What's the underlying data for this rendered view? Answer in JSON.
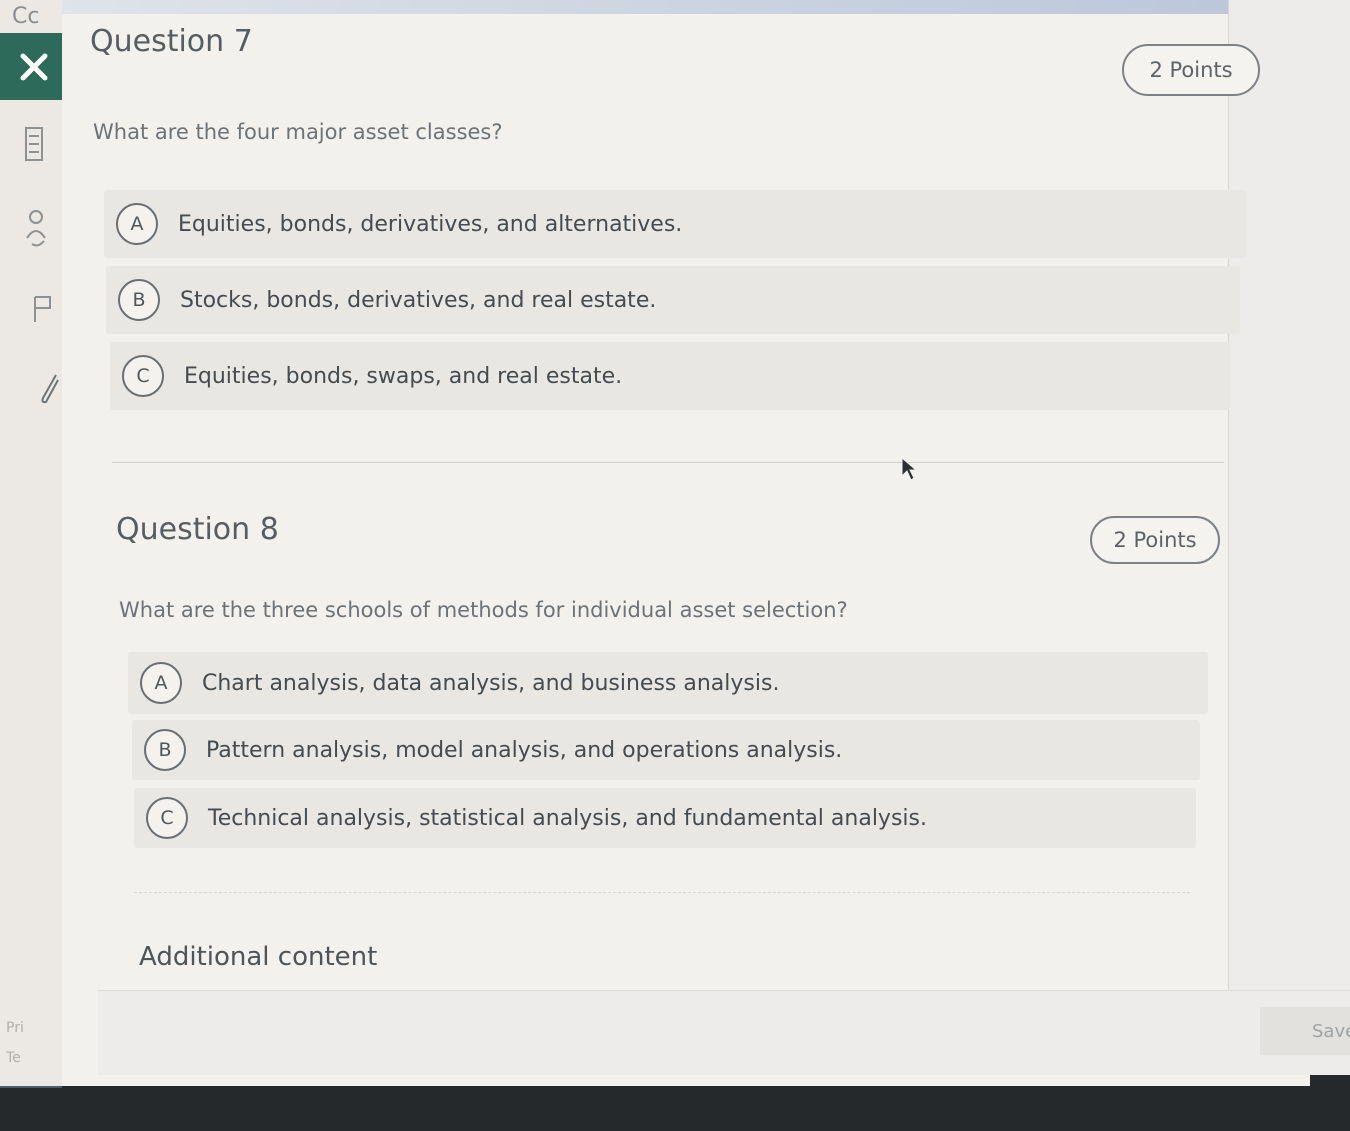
{
  "sidebar": {
    "top_text": "Cc",
    "close_icon": "✕",
    "bottom_text_1": "Pri",
    "bottom_text_2": "Te"
  },
  "questions": [
    {
      "title": "Question 7",
      "points": "2 Points",
      "text": "What are the four major asset classes?",
      "options": [
        {
          "letter": "A",
          "text": "Equities, bonds, derivatives, and alternatives."
        },
        {
          "letter": "B",
          "text": "Stocks, bonds, derivatives, and real estate."
        },
        {
          "letter": "C",
          "text": "Equities, bonds, swaps, and real estate."
        }
      ]
    },
    {
      "title": "Question 8",
      "points": "2 Points",
      "text": "What are the three schools of methods for individual asset selection?",
      "options": [
        {
          "letter": "A",
          "text": "Chart analysis, data analysis, and business analysis."
        },
        {
          "letter": "B",
          "text": "Pattern analysis, model analysis, and operations analysis."
        },
        {
          "letter": "C",
          "text": "Technical analysis, statistical analysis, and fundamental analysis."
        }
      ]
    }
  ],
  "additional_content": "Additional content",
  "footer": {
    "save_label": "Save"
  },
  "colors": {
    "close_bg": "#2d6a59",
    "panel_bg": "#f2f1ee",
    "option_bg": "#e8e7e3"
  }
}
